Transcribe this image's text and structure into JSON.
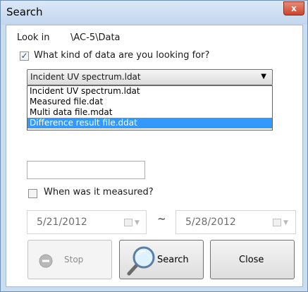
{
  "window": {
    "title": "Search",
    "close_glyph": "x"
  },
  "look_in": {
    "label": "Look in",
    "value": "\\AC-5\\Data"
  },
  "data_kind": {
    "checked": true,
    "label": "What kind of data are you  looking for?",
    "selected": "Incident UV spectrum.ldat",
    "options": [
      "Incident UV spectrum.ldat",
      "Measured file.dat",
      "Multi data file.mdat",
      "Difference result file.ddat"
    ],
    "highlighted_index": 3
  },
  "comment_field": {
    "value": ""
  },
  "measured": {
    "checked": false,
    "label": "When was it measured?",
    "from_date": "5/21/2012",
    "separator": "~",
    "to_date": "5/28/2012"
  },
  "buttons": {
    "stop": "Stop",
    "search": "Search",
    "close": "Close"
  },
  "icons": {
    "stop": "stop-circle-icon",
    "search": "magnifier-icon",
    "calendar": "calendar-icon"
  },
  "colors": {
    "selection": "#3399ff",
    "titlebar": "#c9dcf0",
    "close": "#c9452c"
  }
}
